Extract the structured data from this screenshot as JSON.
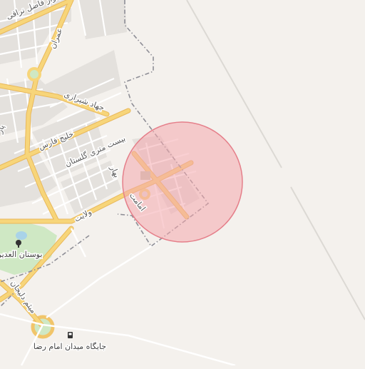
{
  "map": {
    "colors": {
      "land": "#f4f1ed",
      "block": "#e4e1dd",
      "major_road": "#f7d57a",
      "major_road_casing": "#e9b85a",
      "minor_road": "#ffffff",
      "minor_road_casing": "#d6d2cc",
      "park": "#cfe8c4",
      "boundary": "#8e8e96",
      "highlight_fill": "#f4a7ad",
      "highlight_stroke": "#e57f8a"
    },
    "street_labels": [
      "بلوار فاضل نراقی",
      "عمران",
      "جهاد شیرازی",
      "خلیج فارس",
      "بیست متری گلستان",
      "بهار",
      "امامت",
      "ولایت",
      "میثم دلیجان",
      "پار"
    ],
    "poi_labels": {
      "park": "بوستان الغدیر",
      "fuel_station": "جایگاه میدان امام رضا"
    },
    "icons": {
      "park": "tree-icon",
      "fuel_station": "fuel-pump-icon"
    }
  }
}
